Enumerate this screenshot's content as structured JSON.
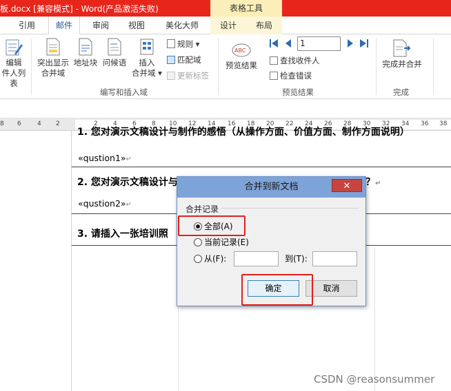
{
  "titlebar": {
    "title": "板.docx [兼容模式] - Word(产品激活失败)",
    "table_tools": "表格工具"
  },
  "tabs": {
    "reference": "引用",
    "mailings": "邮件",
    "review": "审阅",
    "view": "视图",
    "beautify": "美化大师",
    "design": "设计",
    "layout": "布局"
  },
  "ribbon": {
    "edit_recipients_1": "编辑",
    "edit_recipients_2": "件人列表",
    "highlight_1": "突出显示",
    "highlight_2": "合并域",
    "address_block": "地址块",
    "greeting_line": "问候语",
    "insert_1": "插入",
    "insert_2": "合并域 ▾",
    "rules": "规则 ▾",
    "match_fields": "匹配域",
    "update_labels": "更新标签",
    "group_write": "编写和插入域",
    "preview_results": "预览结果",
    "record_value": "1",
    "find_recipient": "查找收件人",
    "check_errors": "检查错误",
    "group_preview": "预览结果",
    "finish_merge": "完成并合并",
    "group_finish": "完成"
  },
  "ruler": {
    "ticks_left": [
      "8",
      "6",
      "4",
      "2"
    ],
    "ticks_right": [
      "2",
      "4",
      "6",
      "8",
      "10",
      "12",
      "14",
      "16",
      "18",
      "20",
      "22",
      "24",
      "26",
      "28",
      "30",
      "32",
      "34",
      "36",
      "38"
    ]
  },
  "document": {
    "q1_partial": "1. 您对演示文稿设计与制作的感悟（从操作方面、价值方面、制作方面说明）",
    "field1": "«qustion1»",
    "q2": "2. 您对演示文稿设计与...",
    "q2_tail": "？",
    "field2": "«qustion2»",
    "q3": "3. 请插入一张培训照"
  },
  "dialog": {
    "title": "合并到新文档",
    "close": "✕",
    "group_label": "合并记录",
    "opt_all": "全部(A)",
    "opt_current": "当前记录(E)",
    "opt_from": "从(F):",
    "to_label": "到(T):",
    "ok": "确定",
    "cancel": "取消"
  },
  "watermark": "CSDN @reasonsummer",
  "colors": {
    "titlebar": "#e8251b",
    "dialog_title": "#7ea3d8",
    "highlight_box": "#e0201c"
  }
}
